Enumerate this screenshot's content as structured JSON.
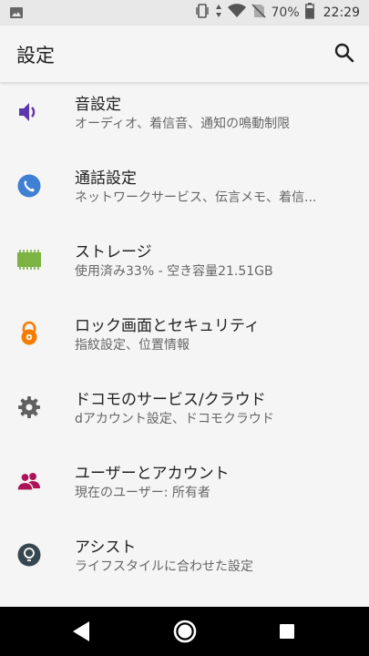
{
  "status_bar": {
    "battery": "70%",
    "time": "22:29"
  },
  "app_bar": {
    "title": "設定"
  },
  "items": [
    {
      "title": "音設定",
      "subtitle": "オーディオ、着信音、通知の鳴動制限",
      "icon": "speaker-icon",
      "color": "#5e35b1"
    },
    {
      "title": "通話設定",
      "subtitle": "ネットワークサービス、伝言メモ、着信...",
      "icon": "phone-icon",
      "color": "#3f7fd4"
    },
    {
      "title": "ストレージ",
      "subtitle": "使用済み33% - 空き容量21.51GB",
      "icon": "storage-chip-icon",
      "color": "#7cb342"
    },
    {
      "title": "ロック画面とセキュリティ",
      "subtitle": "指紋設定、位置情報",
      "icon": "lock-icon",
      "color": "#f57c00"
    },
    {
      "title": "ドコモのサービス/クラウド",
      "subtitle": "dアカウント設定、ドコモクラウド",
      "icon": "gear-icon",
      "color": "#616161"
    },
    {
      "title": "ユーザーとアカウント",
      "subtitle": "現在のユーザー: 所有者",
      "icon": "users-icon",
      "color": "#ad1457"
    },
    {
      "title": "アシスト",
      "subtitle": "ライフスタイルに合わせた設定",
      "icon": "lightbulb-icon",
      "color": "#37474f"
    }
  ]
}
